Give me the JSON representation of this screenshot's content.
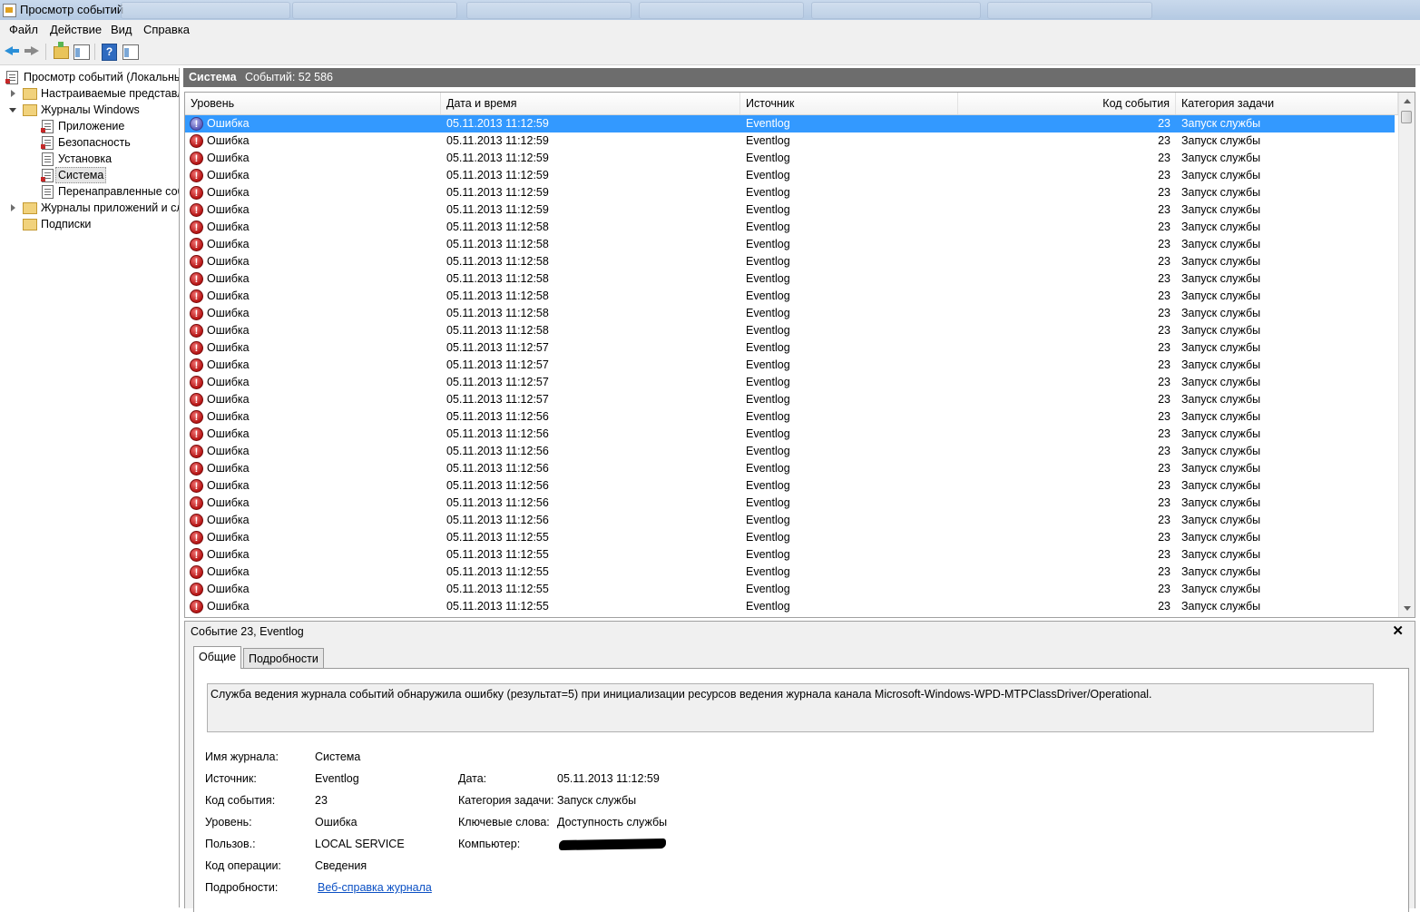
{
  "window": {
    "title": "Просмотр событий",
    "menu": [
      "Файл",
      "Действие",
      "Вид",
      "Справка"
    ]
  },
  "tree": {
    "items": [
      {
        "label": "Просмотр событий (Локальный)",
        "level": 0,
        "icon": "event-viewer-icon"
      },
      {
        "label": "Настраиваемые представления",
        "level": 1,
        "icon": "folder-icon",
        "expander": "closed"
      },
      {
        "label": "Журналы Windows",
        "level": 1,
        "icon": "folder-icon",
        "expander": "open"
      },
      {
        "label": "Приложение",
        "level": 2,
        "icon": "log-icon"
      },
      {
        "label": "Безопасность",
        "level": 2,
        "icon": "log-icon"
      },
      {
        "label": "Установка",
        "level": 2,
        "icon": "log-icon"
      },
      {
        "label": "Система",
        "level": 2,
        "icon": "log-icon",
        "selected": true
      },
      {
        "label": "Перенаправленные события",
        "level": 2,
        "icon": "log-icon"
      },
      {
        "label": "Журналы приложений и служб",
        "level": 1,
        "icon": "folder-icon",
        "expander": "closed"
      },
      {
        "label": "Подписки",
        "level": 1,
        "icon": "folder-icon"
      }
    ]
  },
  "log_header": {
    "name": "Система",
    "count_text": "Событий: 52 586"
  },
  "columns": {
    "level": "Уровень",
    "datetime": "Дата и время",
    "source": "Источник",
    "event_id": "Код события",
    "category": "Категория задачи"
  },
  "events": [
    {
      "level": "Ошибка",
      "datetime": "05.11.2013 11:12:59",
      "source": "Eventlog",
      "event_id": "23",
      "category": "Запуск службы",
      "selected": true
    },
    {
      "level": "Ошибка",
      "datetime": "05.11.2013 11:12:59",
      "source": "Eventlog",
      "event_id": "23",
      "category": "Запуск службы"
    },
    {
      "level": "Ошибка",
      "datetime": "05.11.2013 11:12:59",
      "source": "Eventlog",
      "event_id": "23",
      "category": "Запуск службы"
    },
    {
      "level": "Ошибка",
      "datetime": "05.11.2013 11:12:59",
      "source": "Eventlog",
      "event_id": "23",
      "category": "Запуск службы"
    },
    {
      "level": "Ошибка",
      "datetime": "05.11.2013 11:12:59",
      "source": "Eventlog",
      "event_id": "23",
      "category": "Запуск службы"
    },
    {
      "level": "Ошибка",
      "datetime": "05.11.2013 11:12:59",
      "source": "Eventlog",
      "event_id": "23",
      "category": "Запуск службы"
    },
    {
      "level": "Ошибка",
      "datetime": "05.11.2013 11:12:58",
      "source": "Eventlog",
      "event_id": "23",
      "category": "Запуск службы"
    },
    {
      "level": "Ошибка",
      "datetime": "05.11.2013 11:12:58",
      "source": "Eventlog",
      "event_id": "23",
      "category": "Запуск службы"
    },
    {
      "level": "Ошибка",
      "datetime": "05.11.2013 11:12:58",
      "source": "Eventlog",
      "event_id": "23",
      "category": "Запуск службы"
    },
    {
      "level": "Ошибка",
      "datetime": "05.11.2013 11:12:58",
      "source": "Eventlog",
      "event_id": "23",
      "category": "Запуск службы"
    },
    {
      "level": "Ошибка",
      "datetime": "05.11.2013 11:12:58",
      "source": "Eventlog",
      "event_id": "23",
      "category": "Запуск службы"
    },
    {
      "level": "Ошибка",
      "datetime": "05.11.2013 11:12:58",
      "source": "Eventlog",
      "event_id": "23",
      "category": "Запуск службы"
    },
    {
      "level": "Ошибка",
      "datetime": "05.11.2013 11:12:58",
      "source": "Eventlog",
      "event_id": "23",
      "category": "Запуск службы"
    },
    {
      "level": "Ошибка",
      "datetime": "05.11.2013 11:12:57",
      "source": "Eventlog",
      "event_id": "23",
      "category": "Запуск службы"
    },
    {
      "level": "Ошибка",
      "datetime": "05.11.2013 11:12:57",
      "source": "Eventlog",
      "event_id": "23",
      "category": "Запуск службы"
    },
    {
      "level": "Ошибка",
      "datetime": "05.11.2013 11:12:57",
      "source": "Eventlog",
      "event_id": "23",
      "category": "Запуск службы"
    },
    {
      "level": "Ошибка",
      "datetime": "05.11.2013 11:12:57",
      "source": "Eventlog",
      "event_id": "23",
      "category": "Запуск службы"
    },
    {
      "level": "Ошибка",
      "datetime": "05.11.2013 11:12:56",
      "source": "Eventlog",
      "event_id": "23",
      "category": "Запуск службы"
    },
    {
      "level": "Ошибка",
      "datetime": "05.11.2013 11:12:56",
      "source": "Eventlog",
      "event_id": "23",
      "category": "Запуск службы"
    },
    {
      "level": "Ошибка",
      "datetime": "05.11.2013 11:12:56",
      "source": "Eventlog",
      "event_id": "23",
      "category": "Запуск службы"
    },
    {
      "level": "Ошибка",
      "datetime": "05.11.2013 11:12:56",
      "source": "Eventlog",
      "event_id": "23",
      "category": "Запуск службы"
    },
    {
      "level": "Ошибка",
      "datetime": "05.11.2013 11:12:56",
      "source": "Eventlog",
      "event_id": "23",
      "category": "Запуск службы"
    },
    {
      "level": "Ошибка",
      "datetime": "05.11.2013 11:12:56",
      "source": "Eventlog",
      "event_id": "23",
      "category": "Запуск службы"
    },
    {
      "level": "Ошибка",
      "datetime": "05.11.2013 11:12:56",
      "source": "Eventlog",
      "event_id": "23",
      "category": "Запуск службы"
    },
    {
      "level": "Ошибка",
      "datetime": "05.11.2013 11:12:55",
      "source": "Eventlog",
      "event_id": "23",
      "category": "Запуск службы"
    },
    {
      "level": "Ошибка",
      "datetime": "05.11.2013 11:12:55",
      "source": "Eventlog",
      "event_id": "23",
      "category": "Запуск службы"
    },
    {
      "level": "Ошибка",
      "datetime": "05.11.2013 11:12:55",
      "source": "Eventlog",
      "event_id": "23",
      "category": "Запуск службы"
    },
    {
      "level": "Ошибка",
      "datetime": "05.11.2013 11:12:55",
      "source": "Eventlog",
      "event_id": "23",
      "category": "Запуск службы"
    },
    {
      "level": "Ошибка",
      "datetime": "05.11.2013 11:12:55",
      "source": "Eventlog",
      "event_id": "23",
      "category": "Запуск службы"
    }
  ],
  "details": {
    "title": "Событие 23, Eventlog",
    "close": "✕",
    "tabs": [
      "Общие",
      "Подробности"
    ],
    "description": "Служба ведения журнала событий обнаружила ошибку (результат=5) при инициализации ресурсов ведения журнала канала Microsoft-Windows-WPD-MTPClassDriver/Operational.",
    "labels": {
      "log_name": "Имя журнала:",
      "source": "Источник:",
      "event_id": "Код события:",
      "level": "Уровень:",
      "user": "Пользов.:",
      "opcode": "Код операции:",
      "more_info": "Подробности:",
      "date": "Дата:",
      "task_category": "Категория задачи:",
      "keywords": "Ключевые слова:",
      "computer": "Компьютер:"
    },
    "values": {
      "log_name": "Система",
      "source": "Eventlog",
      "event_id": "23",
      "level": "Ошибка",
      "user": "LOCAL SERVICE",
      "opcode": "Сведения",
      "more_info_link": "Веб-справка журнала",
      "date": "05.11.2013 11:12:59",
      "task_category": "Запуск службы",
      "keywords": "Доступность службы",
      "computer": ""
    }
  },
  "colors": {
    "selection": "#3399ff",
    "header_bar": "#6d6d6d",
    "error_icon": "#c62828",
    "link": "#0b50c4"
  }
}
